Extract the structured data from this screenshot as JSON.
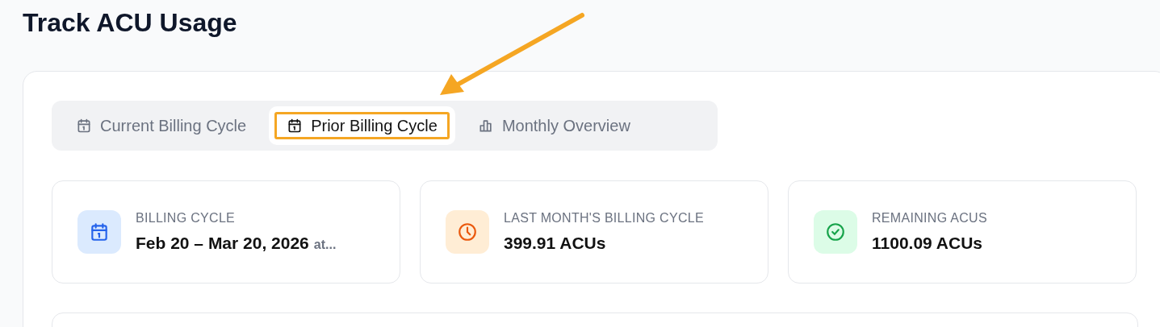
{
  "page": {
    "title": "Track ACU Usage"
  },
  "tabs": [
    {
      "label": "Current Billing Cycle",
      "kind": "calendar",
      "selected": false,
      "highlighted": false
    },
    {
      "label": "Prior Billing Cycle",
      "kind": "calendar",
      "selected": true,
      "highlighted": true
    },
    {
      "label": "Monthly Overview",
      "kind": "chart",
      "selected": false,
      "highlighted": false
    }
  ],
  "annotation_arrow": true,
  "stats": [
    {
      "label": "BILLING CYCLE",
      "value": "Feb 20 – Mar 20, 2026",
      "suffix": "at...",
      "kind": "calendar",
      "color": "#2563eb"
    },
    {
      "label": "LAST MONTH'S BILLING CYCLE",
      "value": "399.91 ACUs",
      "kind": "clock",
      "color": "#ea580c"
    },
    {
      "label": "REMAINING ACUS",
      "value": "1100.09 ACUs",
      "kind": "check",
      "color": "#16a34a"
    }
  ]
}
